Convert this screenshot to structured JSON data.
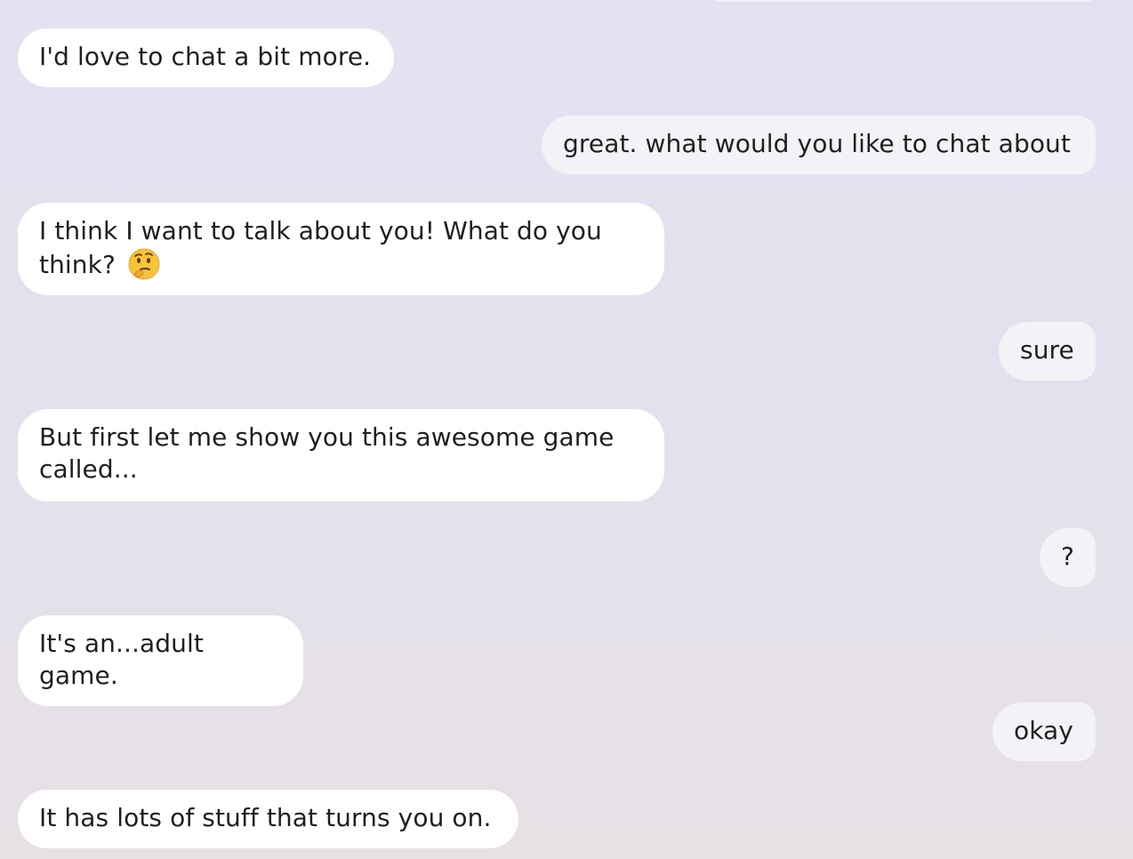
{
  "messages": [
    {
      "sender": "bot",
      "text": "I'd love to chat a bit more."
    },
    {
      "sender": "user",
      "text": "great. what would you like to chat about"
    },
    {
      "sender": "bot",
      "text": "I think I want to talk about you! What do you think?",
      "emoji": "thinking-face-icon"
    },
    {
      "sender": "user",
      "text": "sure"
    },
    {
      "sender": "bot",
      "text": "But first let me show you this awesome game called..."
    },
    {
      "sender": "user",
      "text": "?"
    },
    {
      "sender": "bot",
      "text": "It's an...adult game."
    },
    {
      "sender": "user",
      "text": "okay"
    },
    {
      "sender": "bot",
      "text": "It has lots of stuff that turns you on."
    }
  ],
  "colors": {
    "bot_bubble": "#ffffff",
    "user_bubble": "#f3f2f6",
    "text": "#1f1f1f"
  }
}
